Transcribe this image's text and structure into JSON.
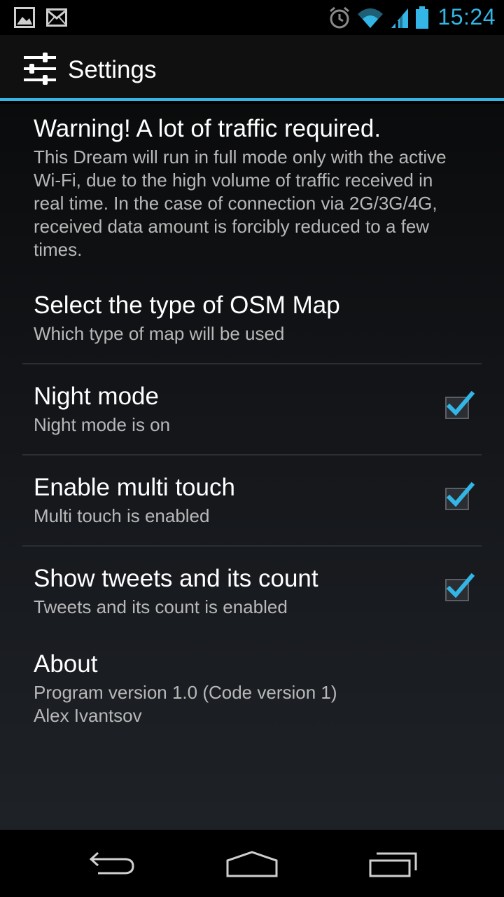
{
  "status_bar": {
    "time": "15:24",
    "accent": "#33b5e5",
    "icons": [
      "picture-icon",
      "mail-icon",
      "alarm-icon",
      "wifi-icon",
      "signal-icon",
      "battery-icon"
    ]
  },
  "action_bar": {
    "title": "Settings",
    "icon": "settings-sliders-icon"
  },
  "preferences": [
    {
      "title": "Warning! A lot of traffic required.",
      "summary": "This Dream will run in full mode only with the active Wi-Fi, due to the high volume of traffic received in real time. In the case of connection via 2G/3G/4G, received data amount is forcibly reduced to a few times."
    },
    {
      "title": "Select the type of OSM Map",
      "summary": "Which type of map will be used"
    },
    {
      "title": "Night mode",
      "summary": "Night mode is on",
      "checked": true
    },
    {
      "title": "Enable multi touch",
      "summary": "Multi touch is enabled",
      "checked": true
    },
    {
      "title": "Show tweets and its count",
      "summary": "Tweets and its count is enabled",
      "checked": true
    },
    {
      "title": "About",
      "summary_line1": "Program version 1.0 (Code version 1)",
      "summary_line2": "Alex Ivantsov"
    }
  ],
  "nav_bar": {
    "buttons": [
      "back-icon",
      "home-icon",
      "recent-apps-icon"
    ]
  }
}
